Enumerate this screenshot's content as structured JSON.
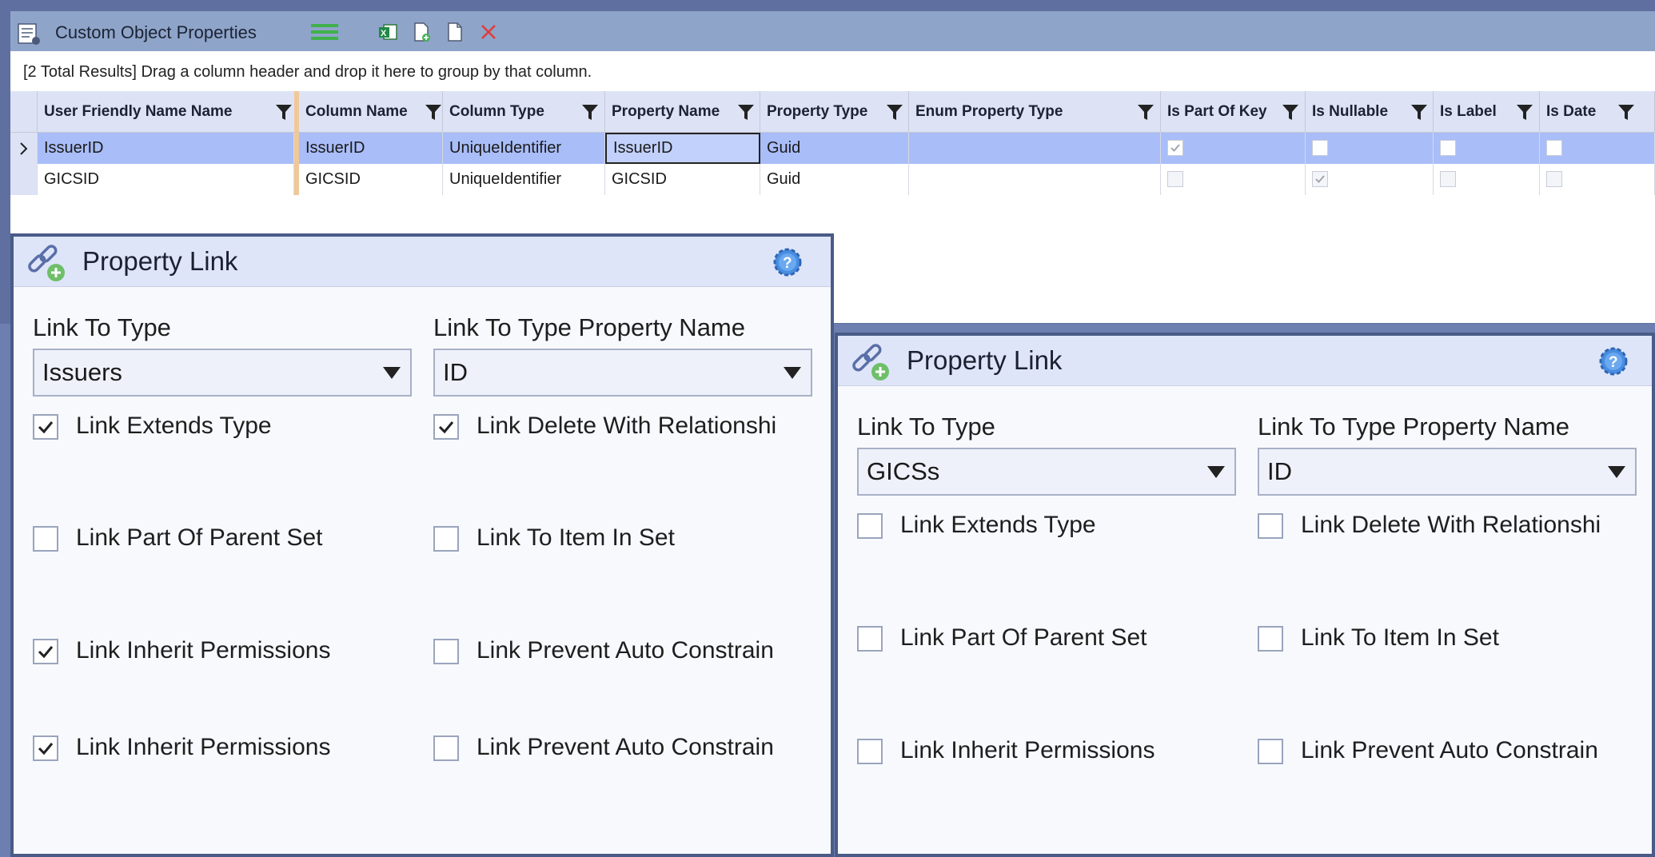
{
  "window": {
    "title": "Custom Object Properties",
    "toolbar_icons": [
      "list-icon",
      "excel-export-icon",
      "new-document-icon",
      "blank-document-icon",
      "delete-icon"
    ],
    "group_hint": "[2 Total Results] Drag a column header and drop it here to group by that column."
  },
  "grid": {
    "columns": [
      "User Friendly Name Name",
      "Column Name",
      "Column Type",
      "Property Name",
      "Property Type",
      "Enum Property Type",
      "Is Part Of Key",
      "Is Nullable",
      "Is Label",
      "Is Date"
    ],
    "rows": [
      {
        "user_friendly_name": "IssuerID",
        "column_name": "IssuerID",
        "column_type": "UniqueIdentifier",
        "property_name": "IssuerID",
        "property_type": "Guid",
        "enum_property_type": "",
        "is_part_of_key": true,
        "is_nullable": false,
        "is_label": false,
        "is_date": false,
        "selected": true
      },
      {
        "user_friendly_name": "GICSID",
        "column_name": "GICSID",
        "column_type": "UniqueIdentifier",
        "property_name": "GICSID",
        "property_type": "Guid",
        "enum_property_type": "",
        "is_part_of_key": false,
        "is_nullable": true,
        "is_label": false,
        "is_date": false,
        "selected": false
      }
    ]
  },
  "panels": [
    {
      "title": "Property Link",
      "link_to_type_label": "Link To Type",
      "link_to_type_value": "Issuers",
      "link_to_type_property_label": "Link To Type Property Name",
      "link_to_type_property_value": "ID",
      "checkboxes": [
        {
          "label": "Link Extends Type",
          "checked": true
        },
        {
          "label": "Link Delete With Relationshi",
          "checked": true
        },
        {
          "label": "Link Part Of Parent Set",
          "checked": false
        },
        {
          "label": "Link To Item In Set",
          "checked": false
        },
        {
          "label": "Link Inherit Permissions",
          "checked": true
        },
        {
          "label": "Link Prevent Auto Constrain",
          "checked": false
        },
        {
          "label": "Link Inherit Permissions",
          "checked": true
        },
        {
          "label": "Link Prevent Auto Constrain",
          "checked": false
        }
      ]
    },
    {
      "title": "Property Link",
      "link_to_type_label": "Link To Type",
      "link_to_type_value": "GICSs",
      "link_to_type_property_label": "Link To Type Property Name",
      "link_to_type_property_value": "ID",
      "checkboxes": [
        {
          "label": "Link Extends Type",
          "checked": false
        },
        {
          "label": "Link Delete With Relationshi",
          "checked": false
        },
        {
          "label": "Link Part Of Parent Set",
          "checked": false
        },
        {
          "label": "Link To Item In Set",
          "checked": false
        },
        {
          "label": "Link Inherit Permissions",
          "checked": false
        },
        {
          "label": "Link Prevent Auto Constrain",
          "checked": false
        }
      ]
    }
  ],
  "colors": {
    "selection": "#a9bdf8",
    "header": "#dde3f5",
    "frame": "#4a5b88",
    "title_bar": "#8fa4c9"
  }
}
